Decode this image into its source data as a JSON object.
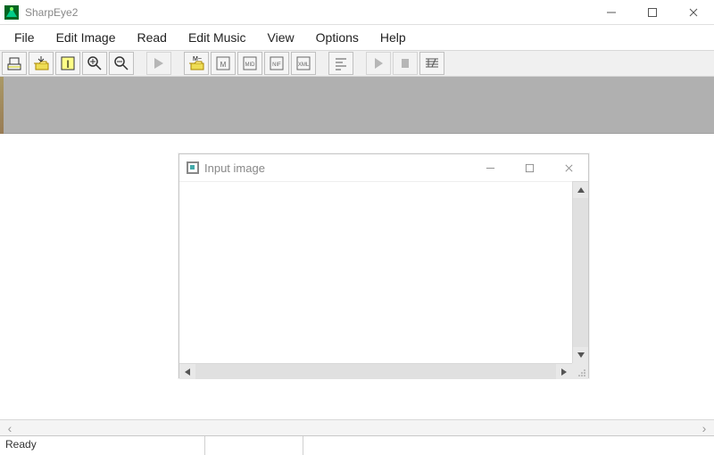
{
  "window": {
    "title": "SharpEye2"
  },
  "menubar": {
    "items": [
      {
        "label": "File"
      },
      {
        "label": "Edit Image"
      },
      {
        "label": "Read"
      },
      {
        "label": "Edit Music"
      },
      {
        "label": "View"
      },
      {
        "label": "Options"
      },
      {
        "label": "Help"
      }
    ]
  },
  "child_window": {
    "title": "Input image"
  },
  "statusbar": {
    "message": "Ready"
  }
}
